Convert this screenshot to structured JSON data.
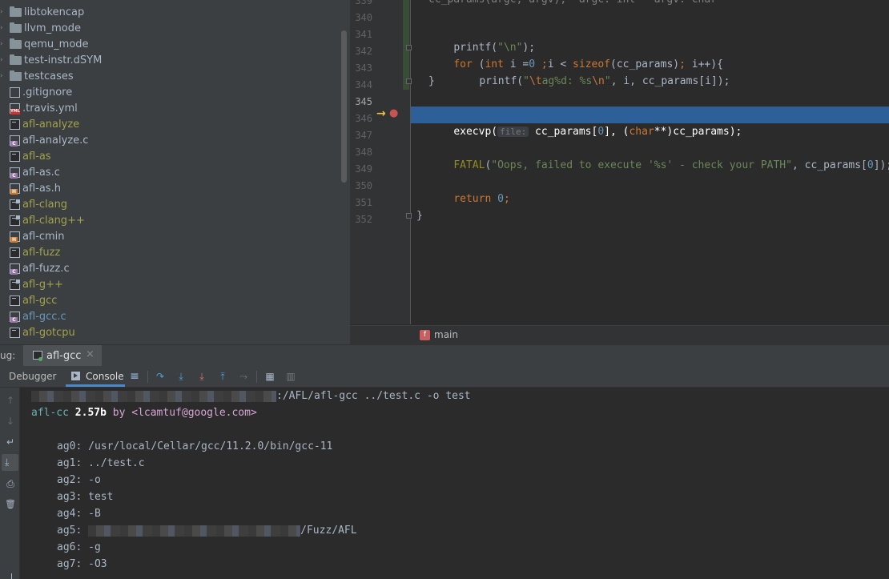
{
  "project_tree": {
    "items": [
      {
        "name": "libtokencap",
        "type": "folder",
        "color": "#a9b7c6",
        "arrow": true
      },
      {
        "name": "llvm_mode",
        "type": "folder",
        "color": "#a9b7c6",
        "arrow": true
      },
      {
        "name": "qemu_mode",
        "type": "folder",
        "color": "#a9b7c6",
        "arrow": true
      },
      {
        "name": "test-instr.dSYM",
        "type": "folder",
        "color": "#a9b7c6",
        "arrow": true
      },
      {
        "name": "testcases",
        "type": "folder",
        "color": "#a9b7c6",
        "arrow": true
      },
      {
        "name": ".gitignore",
        "type": "git",
        "color": "#a9b7c6"
      },
      {
        "name": ".travis.yml",
        "type": "yml",
        "color": "#a9b7c6"
      },
      {
        "name": "afl-analyze",
        "type": "exec",
        "color": "#a2a24c"
      },
      {
        "name": "afl-analyze.c",
        "type": "c",
        "color": "#a9b7c6"
      },
      {
        "name": "afl-as",
        "type": "exec",
        "color": "#a2a24c"
      },
      {
        "name": "afl-as.c",
        "type": "c",
        "color": "#a9b7c6"
      },
      {
        "name": "afl-as.h",
        "type": "h",
        "color": "#a9b7c6"
      },
      {
        "name": "afl-clang",
        "type": "exec2",
        "color": "#a2a24c"
      },
      {
        "name": "afl-clang++",
        "type": "exec2",
        "color": "#a2a24c"
      },
      {
        "name": "afl-cmin",
        "type": "h",
        "color": "#a9b7c6"
      },
      {
        "name": "afl-fuzz",
        "type": "exec",
        "color": "#a2a24c"
      },
      {
        "name": "afl-fuzz.c",
        "type": "c",
        "color": "#a9b7c6"
      },
      {
        "name": "afl-g++",
        "type": "exec2",
        "color": "#a2a24c"
      },
      {
        "name": "afl-gcc",
        "type": "exec",
        "color": "#a2a24c"
      },
      {
        "name": "afl-gcc.c",
        "type": "c",
        "color": "#6897bb"
      },
      {
        "name": "afl-gotcpu",
        "type": "exec",
        "color": "#a2a24c"
      }
    ]
  },
  "editor": {
    "line_numbers": [
      "339",
      "340",
      "341",
      "342",
      "343",
      "344",
      "345",
      "346",
      "347",
      "348",
      "349",
      "350",
      "351",
      "352"
    ],
    "current_line": "345",
    "code": {
      "l339": "cc_params(argc, argv);  argc: int   argv: char",
      "l340_fn": "printf(",
      "l340_str": "\"\\n\"",
      "l340_end": ");",
      "l341_for": "for",
      "l341_open": " (",
      "l341_int": "int",
      "l341_mid": " i =",
      "l341_zero": "0",
      "l341_semi1": " ;",
      "l341_cond": "i < ",
      "l341_sizeof": "sizeof",
      "l341_rest": "(cc_params)",
      "l341_semi2": ";",
      "l341_inc": " i++){",
      "l342_fn": "printf(",
      "l342_str1": "\"",
      "l342_esc1": "\\t",
      "l342_str2": "ag%d: %s",
      "l342_esc2": "\\n",
      "l342_str3": "\"",
      "l342_rest": ", i, cc_params[i]);",
      "l343": "}",
      "l345_fn": "execvp(",
      "l345_hint": "file:",
      "l345_a": " cc_params[",
      "l345_zero": "0",
      "l345_b": "], (",
      "l345_char": "char",
      "l345_c": "**)cc_params);",
      "l347_macro": "FATAL",
      "l347_open": "(",
      "l347_str": "\"Oops, failed to execute '%s' - check your PATH\"",
      "l347_rest": ", cc_params[",
      "l347_zero": "0",
      "l347_end": "]);",
      "l349_ret": "return",
      "l349_zero": "0",
      "l349_semi": ";",
      "l351": "}"
    },
    "breadcrumb": {
      "badge": "f",
      "label": "main"
    }
  },
  "debug": {
    "title": "ug:",
    "session_tab": "afl-gcc",
    "close_glyph": "×",
    "tabs": {
      "debugger": "Debugger",
      "console": "Console"
    }
  },
  "console": {
    "cmd_suffix": ":/AFL/afl-gcc ../test.c -o test",
    "banner_name": "afl-cc",
    "banner_version": "2.57b",
    "banner_by": "by",
    "banner_email": "<lcamtuf@google.com>",
    "args": [
      {
        "label": "ag0:",
        "value": "/usr/local/Cellar/gcc/11.2.0/bin/gcc-11"
      },
      {
        "label": "ag1:",
        "value": "../test.c"
      },
      {
        "label": "ag2:",
        "value": "-o"
      },
      {
        "label": "ag3:",
        "value": "test"
      },
      {
        "label": "ag4:",
        "value": "-B"
      },
      {
        "label": "ag5:",
        "value": "/Fuzz/AFL"
      },
      {
        "label": "ag6:",
        "value": "-g"
      },
      {
        "label": "ag7:",
        "value": "-O3"
      }
    ]
  },
  "icons": {
    "exec_arrow": "→",
    "breakpoint": "●",
    "step_over": "↷",
    "step_into": "⤓",
    "force_step_into": "⤓",
    "step_out": "⤒",
    "run_to_cursor": "⤳",
    "evaluate": "▦",
    "frames": "▥",
    "up": "↑",
    "down": "↓",
    "wrap": "↵",
    "scroll_end": "⤓",
    "print": "⎙",
    "trash": "🗑",
    "list": "≡"
  },
  "colors": {
    "accent": "#4a88c7",
    "current_line": "#2d6099",
    "executable": "#a2a24c"
  }
}
